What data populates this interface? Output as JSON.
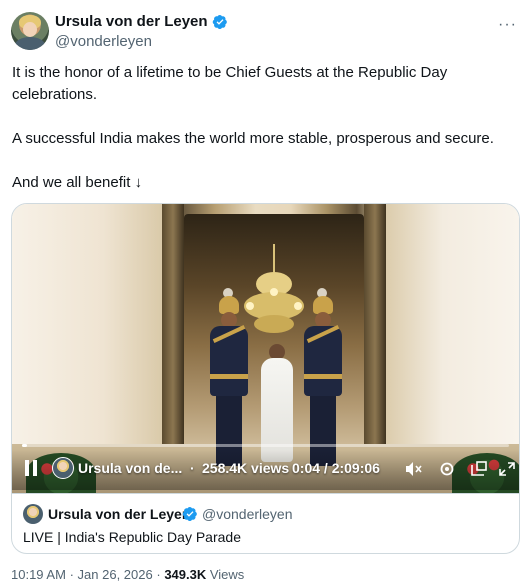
{
  "author": {
    "display_name": "Ursula von der Leyen",
    "handle": "@vonderleyen",
    "verified": true,
    "avatar_icon": "profile-photo-icon"
  },
  "more_icon": "more-horizontal-icon",
  "more_glyph": "···",
  "tweet": {
    "paragraphs": [
      "It is the honor of a lifetime to be Chief Guests at the Republic Day celebrations.",
      "A successful India makes the world more stable, prosperous and secure.",
      "And we all benefit ↓"
    ]
  },
  "video": {
    "state": "playing",
    "channel_name": "Ursula von de...",
    "separator": "·",
    "views": "258.4K views",
    "current_time": "0:04",
    "duration": "2:09:06",
    "time_display": "0:04 / 2:09:06",
    "progress_fraction": 0.004,
    "icons": [
      "pause-icon",
      "volume-muted-icon",
      "settings-gear-icon",
      "pop-out-icon",
      "fullscreen-icon"
    ]
  },
  "card_footer": {
    "author_name": "Ursula von der Leyen",
    "author_handle": "@vonderleyen",
    "title": "LIVE | India's Republic Day Parade"
  },
  "meta": {
    "time": "10:19 AM",
    "separator": "·",
    "date": "Jan 26, 2026",
    "views_count": "349.3K",
    "views_label": "Views"
  },
  "colors": {
    "text_primary": "#0f1419",
    "text_secondary": "#536471",
    "verified_blue": "#1d9bf0",
    "border": "#cfd9de"
  }
}
